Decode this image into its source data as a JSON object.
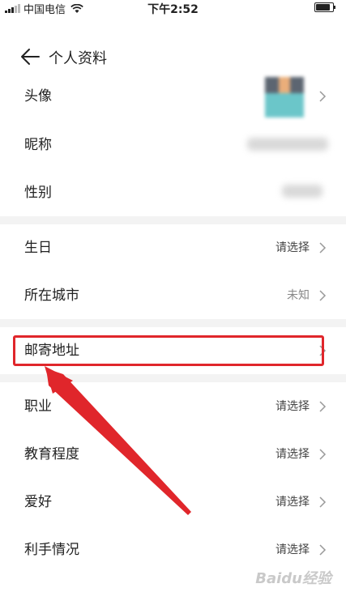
{
  "status_bar": {
    "carrier": "中国电信",
    "time": "下午2:52"
  },
  "header": {
    "title": "个人资料"
  },
  "sections": [
    [
      {
        "label": "头像",
        "value": ""
      },
      {
        "label": "昵称",
        "value": ""
      },
      {
        "label": "性别",
        "value": ""
      }
    ],
    [
      {
        "label": "生日",
        "value": "请选择"
      },
      {
        "label": "所在城市",
        "value": "未知"
      }
    ],
    [
      {
        "label": "邮寄地址",
        "value": ""
      }
    ],
    [
      {
        "label": "职业",
        "value": "请选择"
      },
      {
        "label": "教育程度",
        "value": "请选择"
      },
      {
        "label": "爱好",
        "value": "请选择"
      },
      {
        "label": "利手情况",
        "value": "请选择"
      }
    ]
  ],
  "colors": {
    "highlight": "#e0262b",
    "arrow": "#e0262b",
    "divider": "#f3f3f3"
  },
  "watermark": "Baidu经验"
}
